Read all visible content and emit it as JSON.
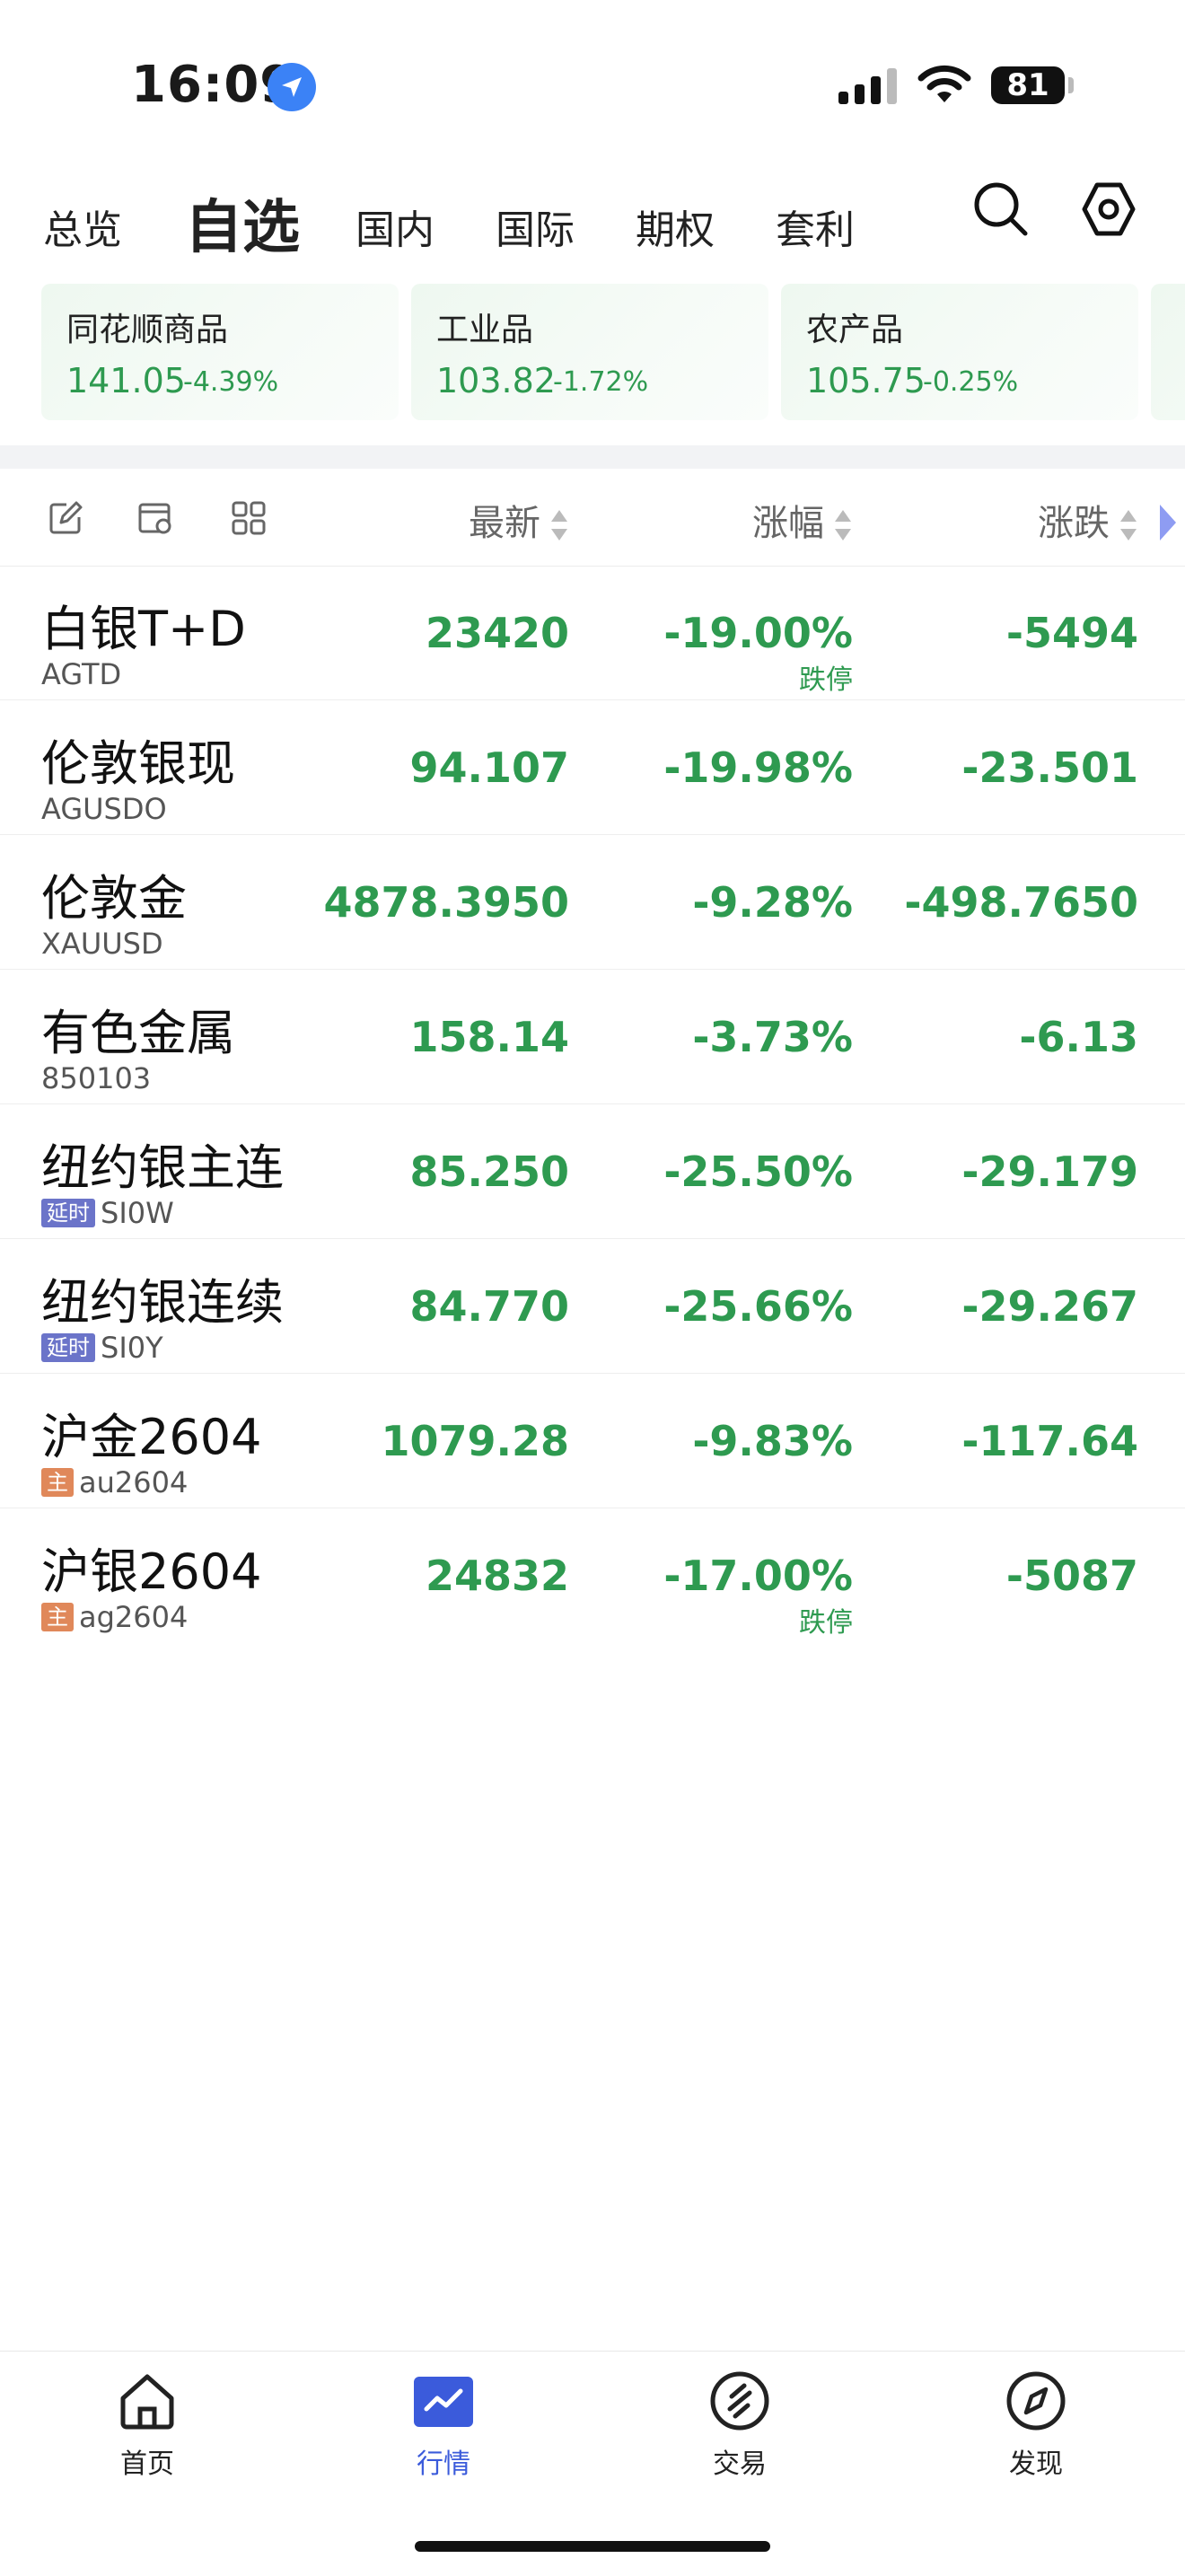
{
  "status_bar": {
    "time": "16:09",
    "battery": "81"
  },
  "tabs": [
    {
      "label": "总览"
    },
    {
      "label": "自选"
    },
    {
      "label": "国内"
    },
    {
      "label": "国际"
    },
    {
      "label": "期权"
    },
    {
      "label": "套利"
    }
  ],
  "index_cards": [
    {
      "name": "同花顺商品",
      "value": "141.05",
      "change": "-4.39%"
    },
    {
      "name": "工业品",
      "value": "103.82",
      "change": "-1.72%"
    },
    {
      "name": "农产品",
      "value": "105.75",
      "change": "-0.25%"
    }
  ],
  "table_header": {
    "latest": "最新",
    "pct": "涨幅",
    "chg": "涨跌"
  },
  "rows": [
    {
      "name": "白银T+D",
      "code": "AGTD",
      "tag": "",
      "latest": "23420",
      "pct": "-19.00%",
      "chg": "-5494",
      "limit": "跌停"
    },
    {
      "name": "伦敦银现",
      "code": "AGUSDO",
      "tag": "",
      "latest": "94.107",
      "pct": "-19.98%",
      "chg": "-23.501",
      "limit": ""
    },
    {
      "name": "伦敦金",
      "code": "XAUUSD",
      "tag": "",
      "latest": "4878.3950",
      "pct": "-9.28%",
      "chg": "-498.7650",
      "limit": ""
    },
    {
      "name": "有色金属",
      "code": "850103",
      "tag": "",
      "latest": "158.14",
      "pct": "-3.73%",
      "chg": "-6.13",
      "limit": ""
    },
    {
      "name": "纽约银主连",
      "code": "SI0W",
      "tag": "延时",
      "latest": "85.250",
      "pct": "-25.50%",
      "chg": "-29.179",
      "limit": ""
    },
    {
      "name": "纽约银连续",
      "code": "SI0Y",
      "tag": "延时",
      "latest": "84.770",
      "pct": "-25.66%",
      "chg": "-29.267",
      "limit": ""
    },
    {
      "name": "沪金2604",
      "code": "au2604",
      "tag": "主",
      "latest": "1079.28",
      "pct": "-9.83%",
      "chg": "-117.64",
      "limit": ""
    },
    {
      "name": "沪银2604",
      "code": "ag2604",
      "tag": "主",
      "latest": "24832",
      "pct": "-17.00%",
      "chg": "-5087",
      "limit": "跌停"
    }
  ],
  "bottom_nav": [
    {
      "label": "首页",
      "icon": "home-icon"
    },
    {
      "label": "行情",
      "icon": "market-icon"
    },
    {
      "label": "交易",
      "icon": "trade-icon"
    },
    {
      "label": "发现",
      "icon": "compass-icon"
    }
  ],
  "colors": {
    "down": "#2e9a50",
    "accent": "#3b5bdb",
    "delay_tag": "#6b74c9",
    "main_tag": "#e0885a"
  }
}
